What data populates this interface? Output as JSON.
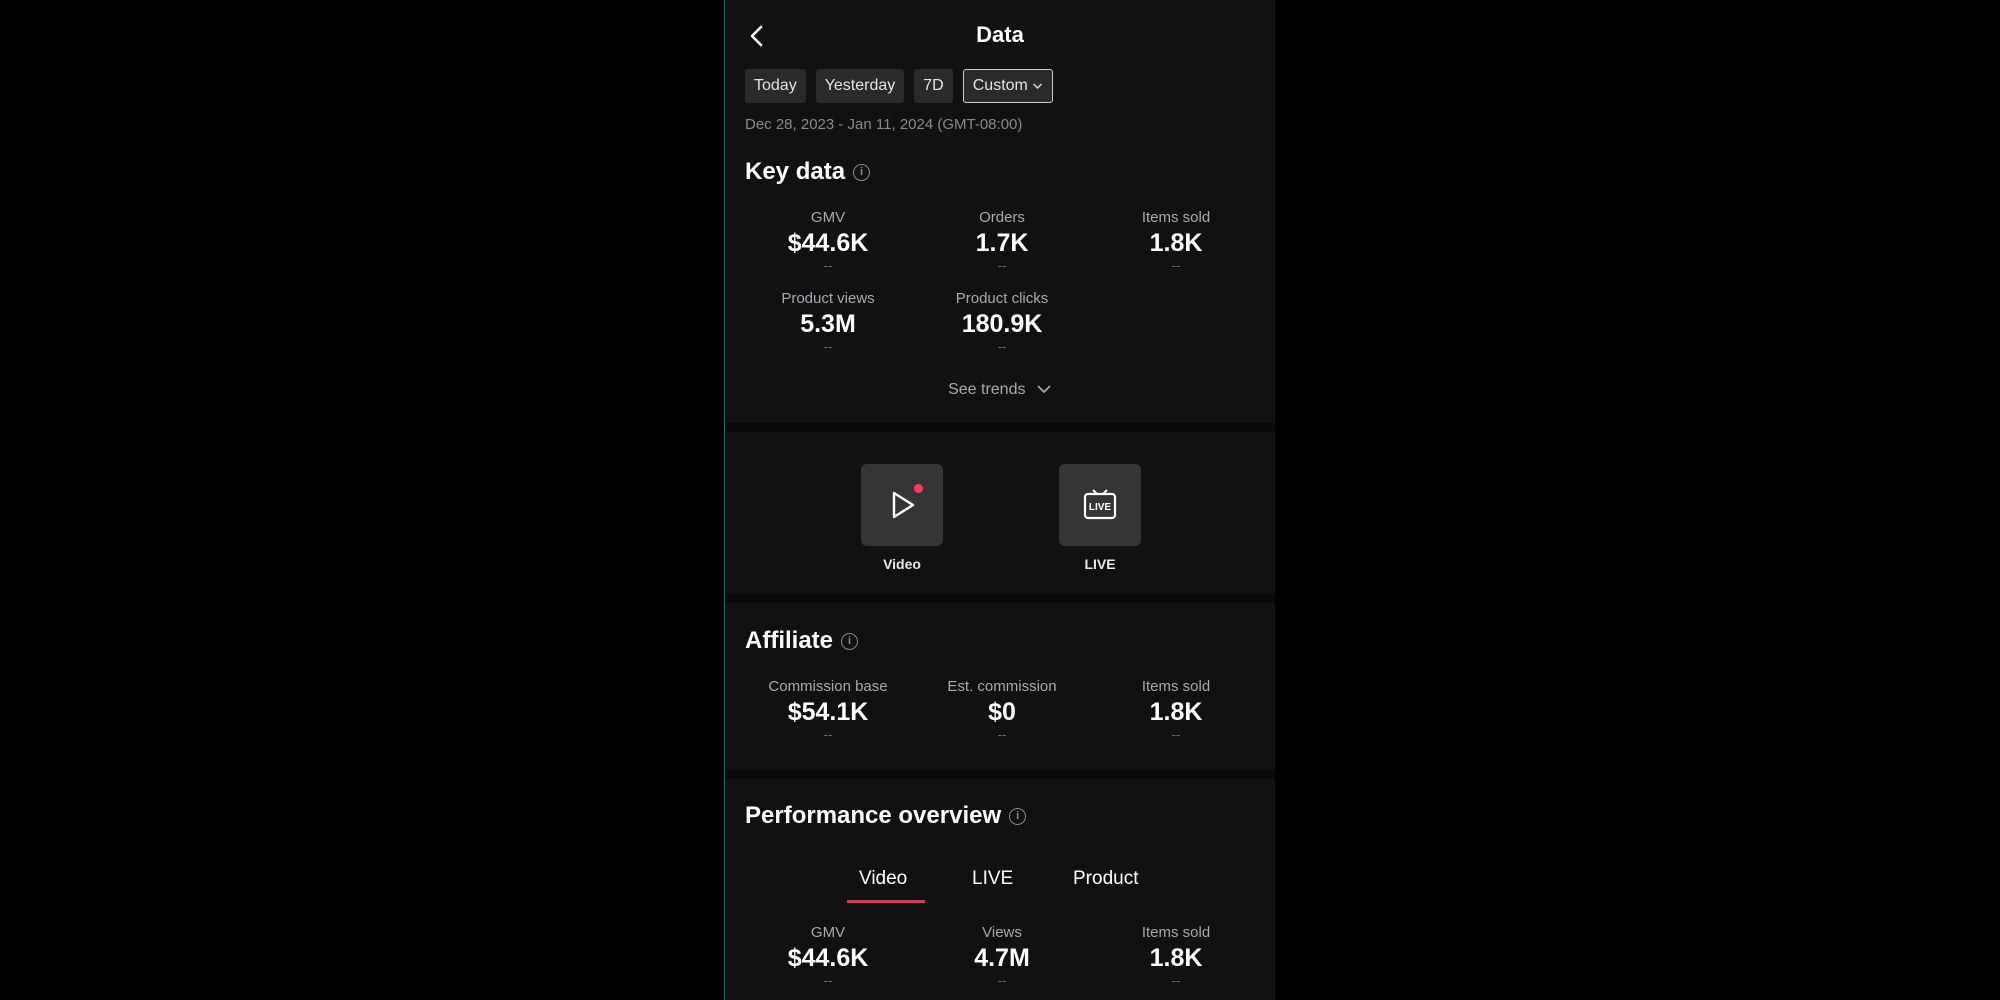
{
  "header": {
    "title": "Data"
  },
  "filters": {
    "chips": [
      "Today",
      "Yesterday",
      "7D"
    ],
    "custom_label": "Custom",
    "date_range": "Dec 28, 2023 - Jan 11, 2024 (GMT-08:00)"
  },
  "key_data": {
    "title": "Key data",
    "metrics": [
      {
        "label": "GMV",
        "value": "$44.6K",
        "compare": "--"
      },
      {
        "label": "Orders",
        "value": "1.7K",
        "compare": "--"
      },
      {
        "label": "Items sold",
        "value": "1.8K",
        "compare": "--"
      },
      {
        "label": "Product views",
        "value": "5.3M",
        "compare": "--"
      },
      {
        "label": "Product clicks",
        "value": "180.9K",
        "compare": "--"
      }
    ],
    "see_trends": "See trends"
  },
  "content_types": {
    "video_label": "Video",
    "live_label": "LIVE",
    "live_icon_text": "LIVE"
  },
  "affiliate": {
    "title": "Affiliate",
    "metrics": [
      {
        "label": "Commission base",
        "value": "$54.1K",
        "compare": "--"
      },
      {
        "label": "Est. commission",
        "value": "$0",
        "compare": "--"
      },
      {
        "label": "Items sold",
        "value": "1.8K",
        "compare": "--"
      }
    ]
  },
  "performance": {
    "title": "Performance overview",
    "tabs": [
      "Video",
      "LIVE",
      "Product"
    ],
    "active_tab": "Video",
    "metrics": [
      {
        "label": "GMV",
        "value": "$44.6K",
        "compare": "--"
      },
      {
        "label": "Views",
        "value": "4.7M",
        "compare": "--"
      },
      {
        "label": "Items sold",
        "value": "1.8K",
        "compare": "--"
      }
    ]
  },
  "colors": {
    "accent": "#e8344e",
    "background": "#111113",
    "notification_dot": "#ff3b5c"
  },
  "icons": {
    "back": "chevron-left-icon",
    "info": "info-icon",
    "video": "play-icon",
    "live": "live-tv-icon",
    "dropdown": "chevron-down-icon"
  }
}
